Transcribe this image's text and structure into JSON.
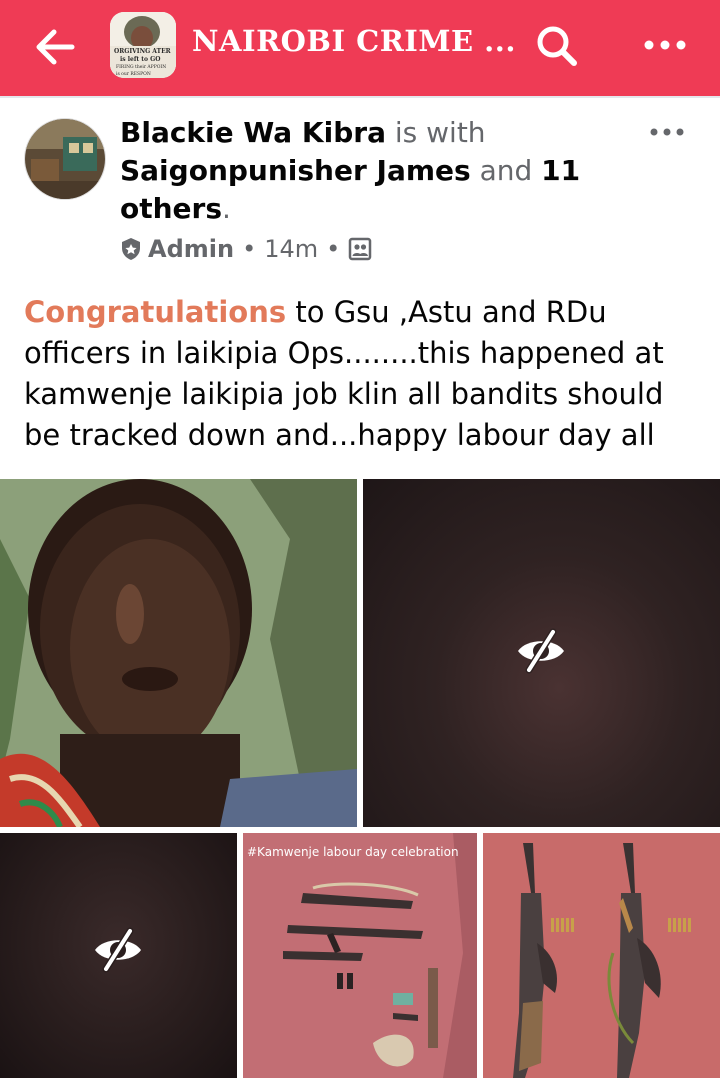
{
  "header": {
    "back_icon": "back-arrow-icon",
    "group_title": "NAIROBI CRIME ...",
    "group_avatar_text": [
      "ORGIVING ATER",
      "is left to GO",
      "FIRING their APPOIN",
      "is our RESPON"
    ],
    "search_icon": "search-icon",
    "more_icon": "more-options-icon",
    "bar_color": "#ef3b55"
  },
  "post": {
    "author": "Blackie Wa Kibra",
    "is_with": "is with",
    "tagged": "Saigonpunisher James",
    "and": "and",
    "others_count": "11",
    "others_label": "others",
    "role": "Admin",
    "time": "14m",
    "audience_icon": "group-audience-icon",
    "text_highlight": "Congratulations",
    "text_body": " to Gsu ,Astu and RDu officers in laikipia Ops........this happened at kamwenje laikipia job klin all bandits should be tracked down and...happy labour day all",
    "highlight_color": "#e27a5a"
  },
  "photos": {
    "photo4_caption": "#Kamwenje labour day celebration",
    "hidden_icon": "eye-slash-icon"
  }
}
